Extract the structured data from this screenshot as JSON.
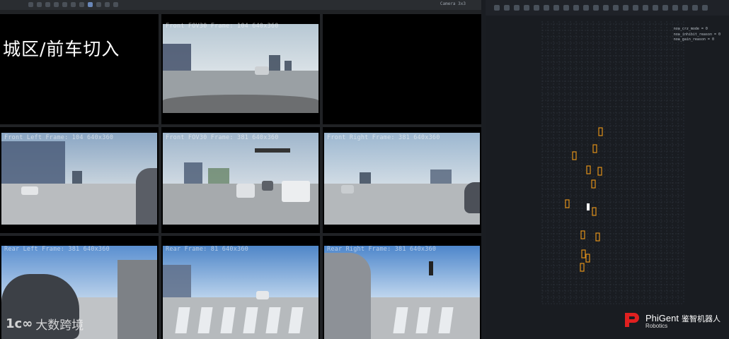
{
  "cam_panel": {
    "toolbar_label": "Camera 3x3",
    "scene_title": "城区/前车切入",
    "cells": [
      {
        "id": "front-fov30",
        "label": "Front FOV30 Frame: 104 640x360"
      },
      {
        "id": "front-left",
        "label": "Front Left Frame: 104 640x360"
      },
      {
        "id": "front-fov30-2",
        "label": "Front FOV30 Frame: 381 640x360"
      },
      {
        "id": "front-right",
        "label": "Front Right Frame: 381 640x360"
      },
      {
        "id": "rear-left",
        "label": "Rear Left Frame: 381 640x360"
      },
      {
        "id": "rear",
        "label": "Rear Frame: 81 640x360"
      },
      {
        "id": "rear-right",
        "label": "Rear Right Frame: 381 640x360"
      }
    ],
    "watermark": {
      "mark": "1c∞",
      "text": "大数跨境"
    }
  },
  "bev_panel": {
    "legend": [
      "noa_crz_mode = 0",
      "noa_inhibit_reason = 0",
      "noa_gain_reason = 0"
    ],
    "logo": {
      "brand": "PhiGent",
      "sub": "Robotics",
      "cn": "鉴智机器人"
    },
    "colors": {
      "grid": "#343a44",
      "obstacle": "#e0901a",
      "ego": "#ffffff",
      "logo_red": "#e02020"
    }
  }
}
